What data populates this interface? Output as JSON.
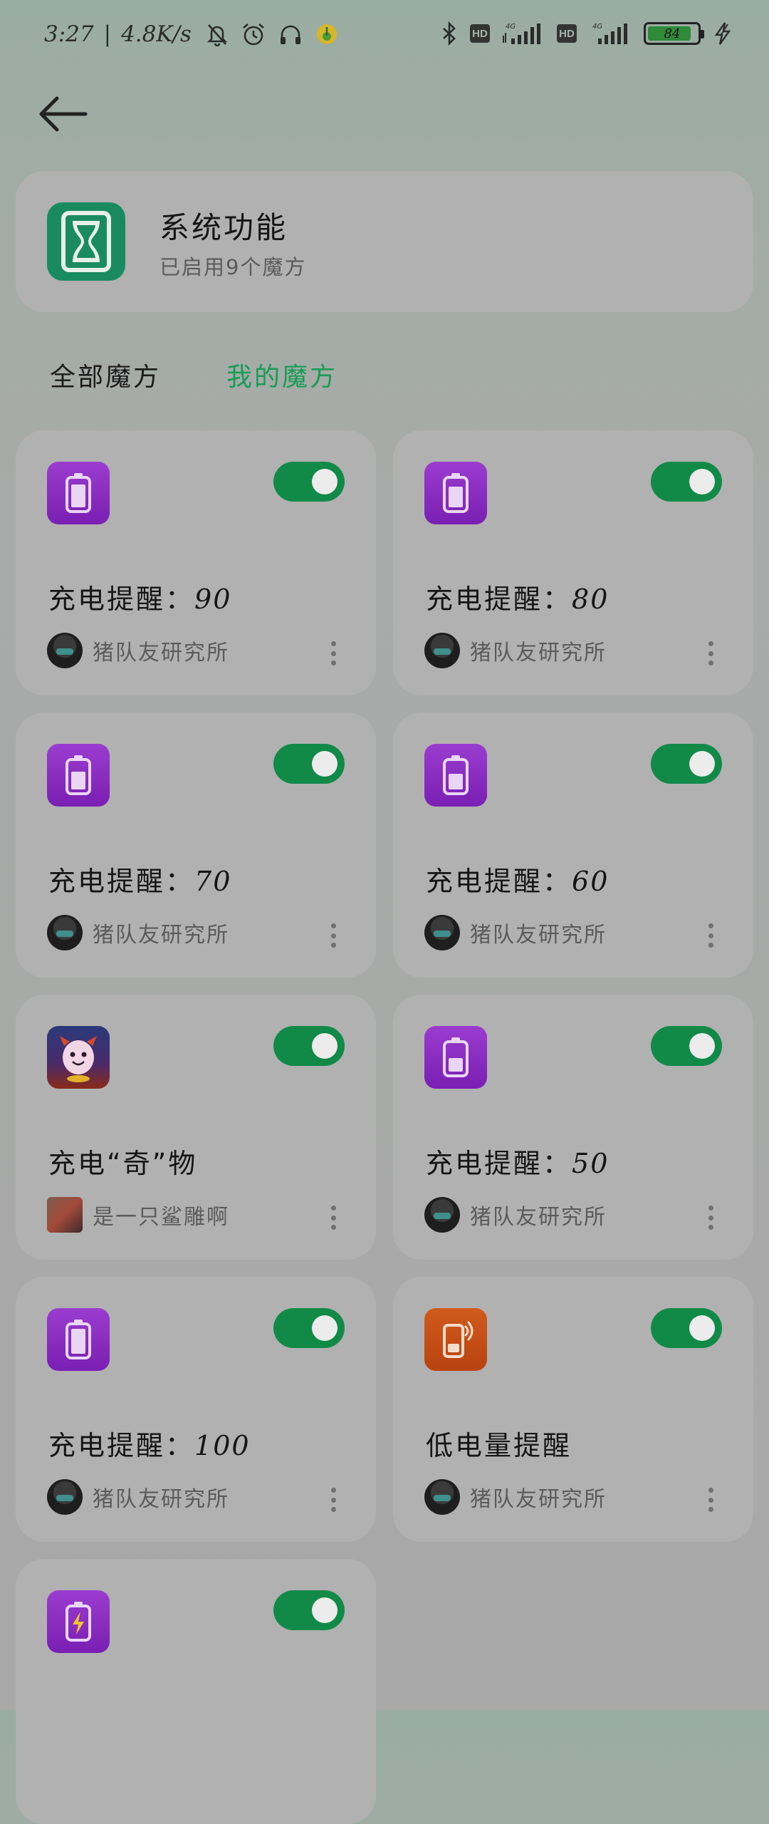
{
  "status_bar": {
    "time": "3:27",
    "net_speed": "4.8K/s",
    "battery_level": "84",
    "icons": [
      "mute-bell-icon",
      "alarm-icon",
      "headset-icon",
      "music-app-icon",
      "bluetooth-icon",
      "hd-icon",
      "signal-4g-icon",
      "hd-icon",
      "signal-4g-icon",
      "battery-icon",
      "charging-icon"
    ],
    "hd_label": "HD"
  },
  "header": {
    "title": "系统功能",
    "subtitle": "已启用9个魔方",
    "icon": "hourglass-icon"
  },
  "tabs": [
    {
      "label": "全部魔方",
      "active": false
    },
    {
      "label": "我的魔方",
      "active": true
    }
  ],
  "colors": {
    "accent": "#179c55",
    "toggle_on": "#118a48",
    "app_icon_green": "#1a8b61",
    "icon_purple": "#8a2cc4",
    "icon_orange": "#c4501a"
  },
  "cards": [
    {
      "title": "充电提醒：",
      "num": "90",
      "author": "猪队友研究所",
      "enabled": true,
      "icon": "battery-icon"
    },
    {
      "title": "充电提醒：",
      "num": "80",
      "author": "猪队友研究所",
      "enabled": true,
      "icon": "battery-icon"
    },
    {
      "title": "充电提醒：",
      "num": "70",
      "author": "猪队友研究所",
      "enabled": true,
      "icon": "battery-icon"
    },
    {
      "title": "充电提醒：",
      "num": "60",
      "author": "猪队友研究所",
      "enabled": true,
      "icon": "battery-icon"
    },
    {
      "title": "充电“奇”物",
      "num": "",
      "author": "是一只鲨雕啊",
      "enabled": true,
      "icon": "monster-icon"
    },
    {
      "title": "充电提醒：",
      "num": "50",
      "author": "猪队友研究所",
      "enabled": true,
      "icon": "battery-icon"
    },
    {
      "title": "充电提醒：",
      "num": "100",
      "author": "猪队友研究所",
      "enabled": true,
      "icon": "battery-icon"
    },
    {
      "title": "低电量提醒",
      "num": "",
      "author": "猪队友研究所",
      "enabled": true,
      "icon": "phone-vibrate-icon"
    },
    {
      "title": "",
      "num": "",
      "author": "",
      "enabled": true,
      "icon": "battery-charging-icon"
    }
  ]
}
